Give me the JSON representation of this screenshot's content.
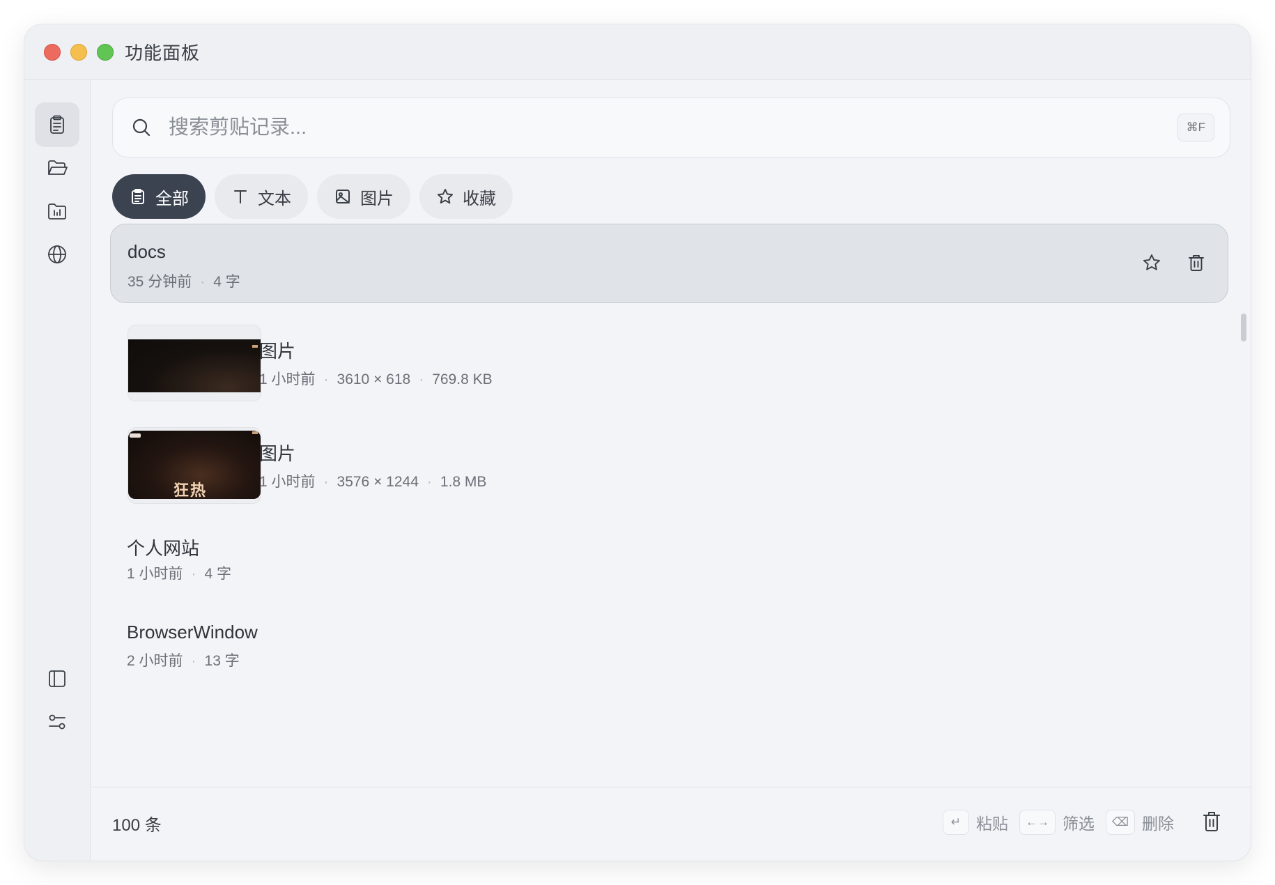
{
  "window": {
    "title": "功能面板"
  },
  "sidebar": {
    "items": [
      {
        "icon": "clipboard-icon",
        "active": true
      },
      {
        "icon": "folder-open-icon",
        "active": false
      },
      {
        "icon": "folder-chart-icon",
        "active": false
      },
      {
        "icon": "globe-icon",
        "active": false
      }
    ],
    "bottom": [
      {
        "icon": "panel-toggle-icon"
      },
      {
        "icon": "sliders-icon"
      }
    ]
  },
  "search": {
    "placeholder": "搜索剪贴记录...",
    "shortcut": "⌘F"
  },
  "filters": [
    {
      "label": "全部",
      "icon": "clipboard-icon",
      "active": true
    },
    {
      "label": "文本",
      "icon": "text-icon",
      "active": false
    },
    {
      "label": "图片",
      "icon": "image-icon",
      "active": false
    },
    {
      "label": "收藏",
      "icon": "star-icon",
      "active": false
    }
  ],
  "items": [
    {
      "type": "text",
      "title": "docs",
      "meta": [
        "35 分钟前",
        "4 字"
      ],
      "selected": true
    },
    {
      "type": "image",
      "title": "图片",
      "meta": [
        "1 小时前",
        "3610 × 618",
        "769.8 KB"
      ]
    },
    {
      "type": "image",
      "title": "图片",
      "meta": [
        "1 小时前",
        "3576 × 1244",
        "1.8 MB"
      ],
      "thumb_text": "狂热"
    },
    {
      "type": "text",
      "title": "个人网站",
      "meta": [
        "1 小时前",
        "4 字"
      ]
    },
    {
      "type": "text",
      "title": "BrowserWindow",
      "meta": [
        "2 小时前",
        "13 字"
      ]
    }
  ],
  "footer": {
    "count": "100 条",
    "hints": [
      {
        "key": "↵",
        "label": "粘贴"
      },
      {
        "key": "←→",
        "label": "筛选"
      },
      {
        "key": "⌫",
        "label": "删除"
      }
    ]
  }
}
